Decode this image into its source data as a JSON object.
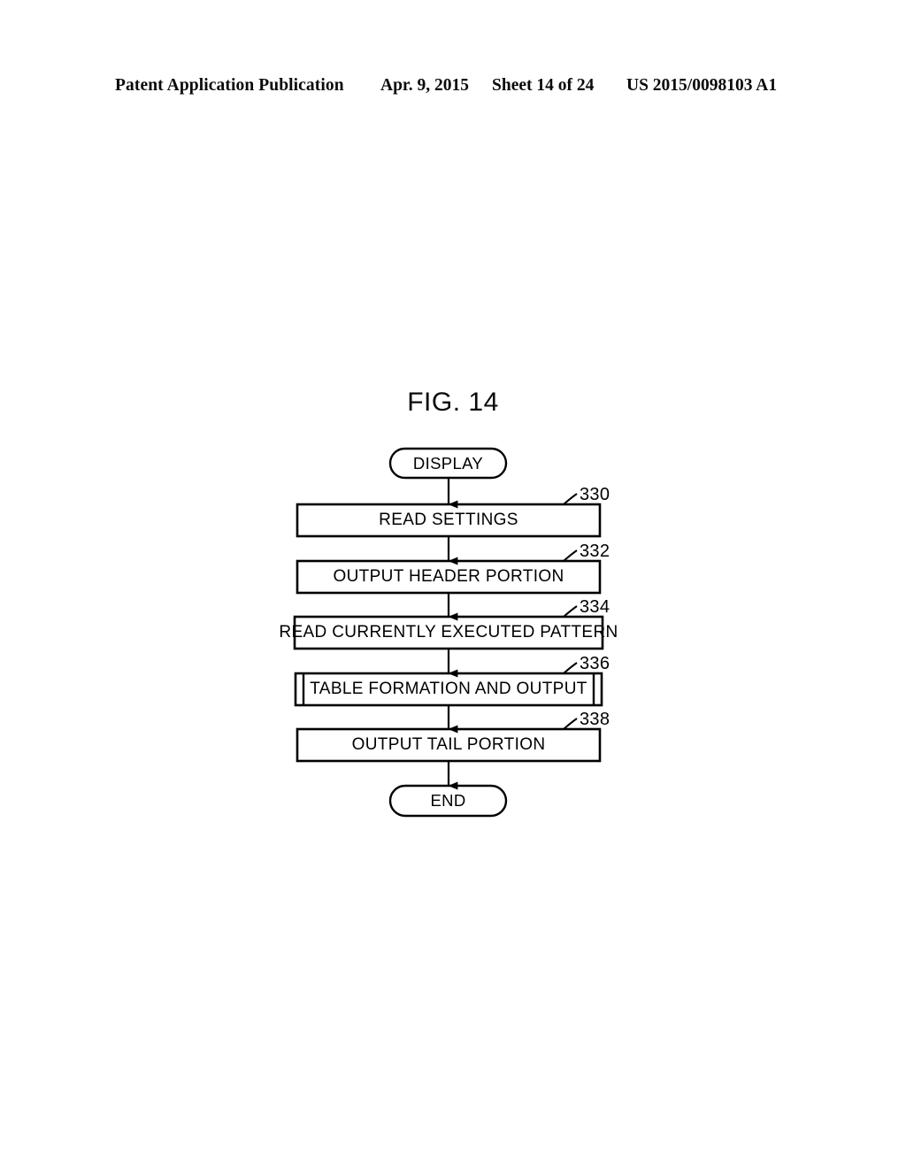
{
  "page": {
    "header": {
      "publication": "Patent Application Publication",
      "date": "Apr. 9, 2015",
      "sheet": "Sheet 14 of 24",
      "pub_number": "US 2015/0098103 A1"
    },
    "figure_title": "FIG. 14"
  },
  "flowchart": {
    "type": "flowchart",
    "orientation": "vertical",
    "nodes": [
      {
        "id": "start",
        "shape": "terminator",
        "label": "DISPLAY",
        "ref": ""
      },
      {
        "id": "s330",
        "shape": "process",
        "label": "READ SETTINGS",
        "ref": "330"
      },
      {
        "id": "s332",
        "shape": "process",
        "label": "OUTPUT HEADER PORTION",
        "ref": "332"
      },
      {
        "id": "s334",
        "shape": "process",
        "label": "READ CURRENTLY EXECUTED PATTERN",
        "ref": "334"
      },
      {
        "id": "s336",
        "shape": "predefined-process",
        "label": "TABLE FORMATION AND OUTPUT",
        "ref": "336"
      },
      {
        "id": "s338",
        "shape": "process",
        "label": "OUTPUT TAIL PORTION",
        "ref": "338"
      },
      {
        "id": "end",
        "shape": "terminator",
        "label": "END",
        "ref": ""
      }
    ],
    "edges": [
      {
        "from": "start",
        "to": "s330",
        "arrow": "down"
      },
      {
        "from": "s330",
        "to": "s332",
        "arrow": "down"
      },
      {
        "from": "s332",
        "to": "s334",
        "arrow": "down"
      },
      {
        "from": "s334",
        "to": "s336",
        "arrow": "down"
      },
      {
        "from": "s336",
        "to": "s338",
        "arrow": "down"
      },
      {
        "from": "s338",
        "to": "end",
        "arrow": "down"
      }
    ],
    "colors": {
      "stroke": "#000000",
      "fill": "#ffffff"
    }
  }
}
